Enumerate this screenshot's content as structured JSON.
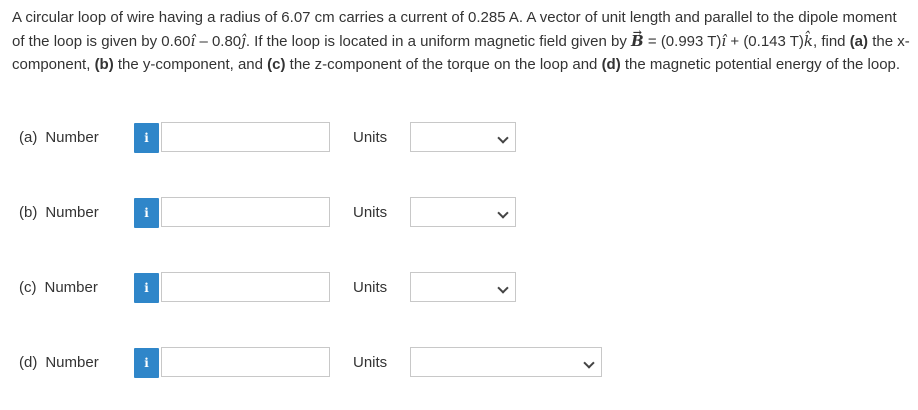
{
  "problem": {
    "text_1": "A circular loop of wire having a radius of 6.07 cm carries a current of 0.285 A. A vector of unit length and parallel to the dipole moment of the loop is given by 0.60",
    "i_hat": "î",
    "text_2": " – 0.80",
    "j_hat": "ĵ",
    "text_3": ". If the loop is located in a uniform magnetic field given by ",
    "B": "B",
    "B_arrow": "→",
    "text_4": " = (0.993 T)",
    "i_hat_2": "î",
    "text_5": " + (0.143 T)",
    "k_hat": "k̂",
    "text_6": ", find ",
    "part_a_tag": "(a)",
    "text_7": " the x-component, ",
    "part_b_tag": "(b)",
    "text_8": " the y-component, and ",
    "part_c_tag": "(c)",
    "text_9": " the z-component of the torque on the loop and ",
    "part_d_tag": "(d)",
    "text_10": " the magnetic potential energy of the loop."
  },
  "rows": [
    {
      "letter": "(a)",
      "label": "Number",
      "info": "i",
      "value": "",
      "units_label": "Units",
      "units_value": ""
    },
    {
      "letter": "(b)",
      "label": "Number",
      "info": "i",
      "value": "",
      "units_label": "Units",
      "units_value": ""
    },
    {
      "letter": "(c)",
      "label": "Number",
      "info": "i",
      "value": "",
      "units_label": "Units",
      "units_value": ""
    },
    {
      "letter": "(d)",
      "label": "Number",
      "info": "i",
      "value": "",
      "units_label": "Units",
      "units_value": ""
    }
  ],
  "colors": {
    "info_button": "#2f86c9",
    "border": "#c8c8c8",
    "text": "#333333"
  }
}
